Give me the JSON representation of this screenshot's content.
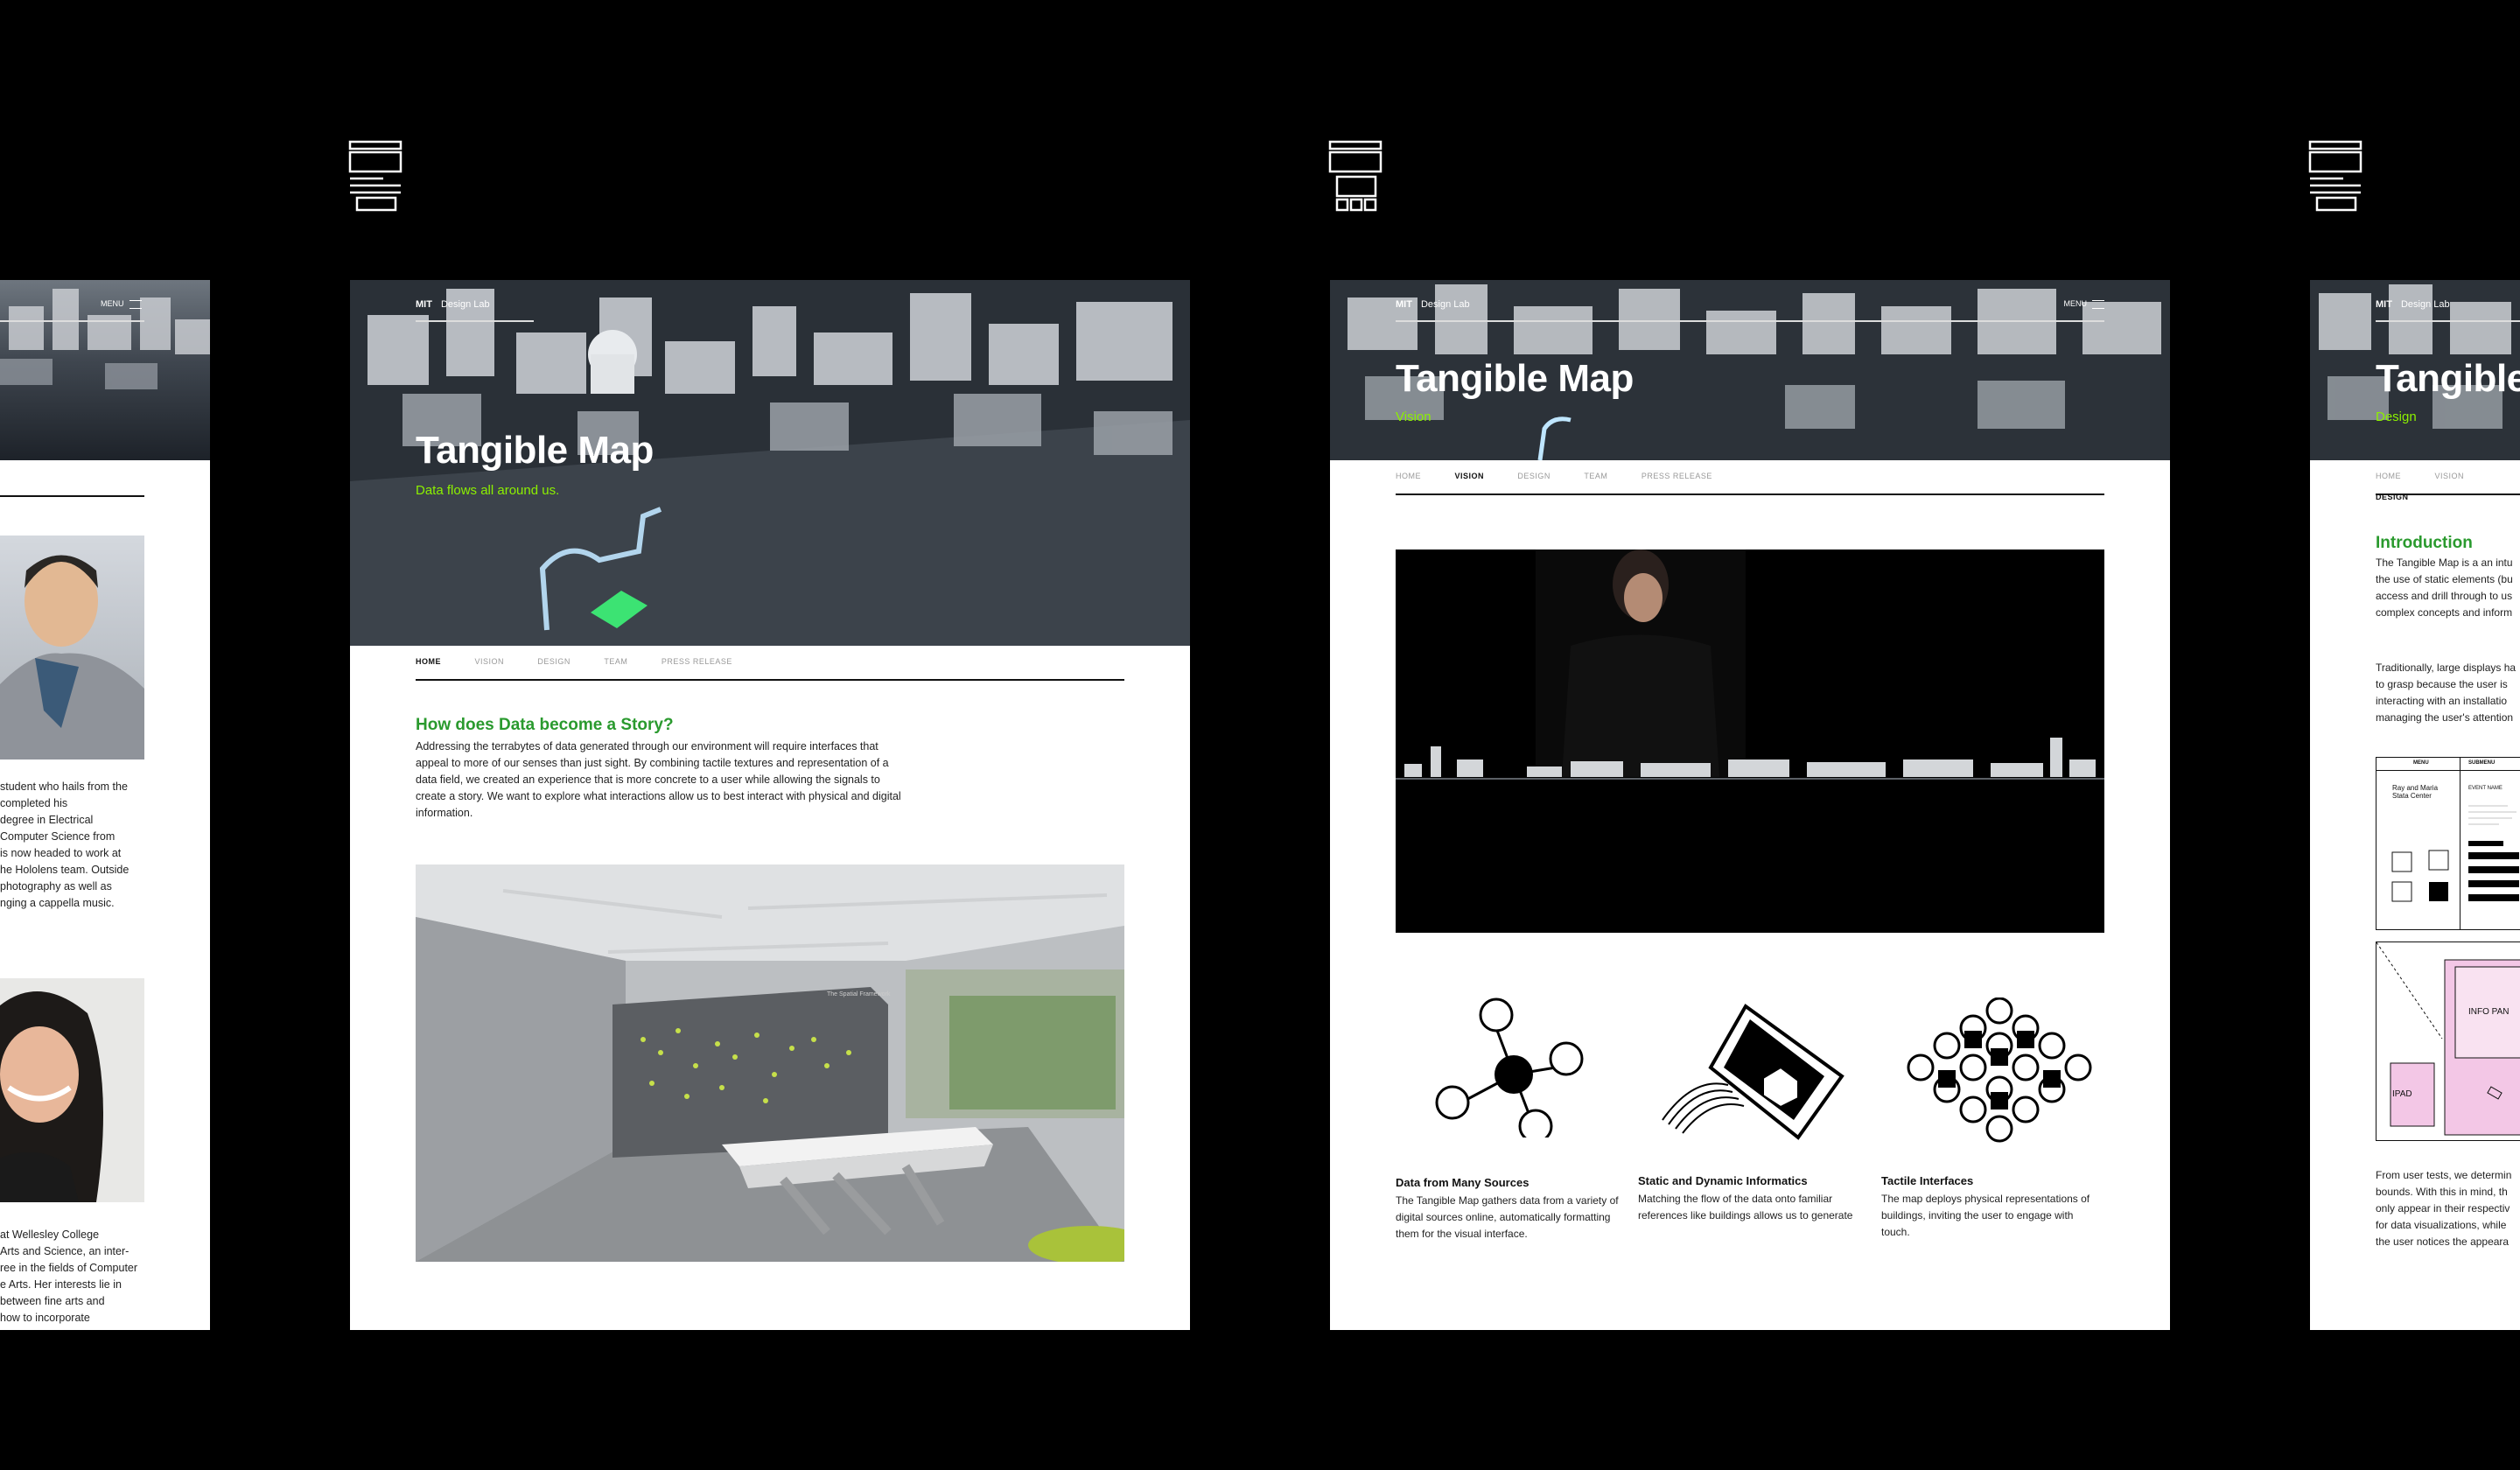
{
  "brand": {
    "mark": "MIT",
    "name": "Design Lab"
  },
  "menu_label": "MENU",
  "colors": {
    "accent_green": "#2a9a2e",
    "subtitle_green": "#8cf000",
    "background": "#000000",
    "pink": "#f3c7e6"
  },
  "team_panel": {
    "bio1": [
      "student who hails from the",
      "completed his",
      "degree in Electrical",
      "Computer Science from",
      "is now headed to work at",
      "he Hololens team. Outside",
      "photography as well as",
      "nging a cappella music."
    ],
    "bio2": [
      "at Wellesley College",
      "Arts and Science, an inter-",
      "ree in the fields of Computer",
      "e Arts. Her interests lie in",
      "between fine arts and",
      "how to incorporate"
    ]
  },
  "home_panel": {
    "title": "Tangible Map",
    "subtitle": "Data flows all around us.",
    "nav": [
      "HOME",
      "VISION",
      "DESIGN",
      "TEAM",
      "PRESS RELEASE"
    ],
    "active_tab": "HOME",
    "heading": "How does Data become a Story?",
    "paragraph": "Addressing the terrabytes of data generated through our environment will require interfaces that appeal to more of our senses than just sight. By combining tactile textures and representation of a data field, we created an experience that is more concrete to a user while allowing the signals to create a story. We want to explore what interactions allow us to best interact with physical and digital information.",
    "wall_text": "The Spatial Framework"
  },
  "vision_panel": {
    "title": "Tangible Map",
    "subtitle": "Vision",
    "nav": [
      "HOME",
      "VISION",
      "DESIGN",
      "TEAM",
      "PRESS RELEASE"
    ],
    "active_tab": "VISION",
    "features": [
      {
        "title": "Data from Many Sources",
        "text": "The Tangible Map gathers data from a variety of digital sources online, automatically formatting them for the visual interface.",
        "icon": "network-icon"
      },
      {
        "title": "Static and Dynamic Informatics",
        "text": "Matching the flow of the data onto familiar references like buildings allows us to generate",
        "icon": "building-flow-icon"
      },
      {
        "title": "Tactile Interfaces",
        "text": "The map deploys physical representations of buildings, inviting the user to engage with touch.",
        "icon": "pin-array-icon"
      }
    ]
  },
  "design_panel": {
    "title": "Tangible",
    "subtitle": "Design",
    "nav": [
      "HOME",
      "VISION",
      "DESIGN"
    ],
    "active_tab": "DESIGN",
    "heading": "Introduction",
    "para1": [
      "The Tangible Map is a an intu",
      "the use of static elements (bu",
      "access and drill through to us",
      "complex concepts and inform"
    ],
    "para2": [
      "Traditionally, large displays ha",
      "to grasp because the user is",
      "interacting with an installatio",
      "managing the user's attention"
    ],
    "para3": [
      "From user tests, we determin",
      "bounds. With this in mind, th",
      "only appear in their respectiv",
      "for data visualizations, while",
      "the user notices the appeara"
    ],
    "wire": {
      "menu": "MENU",
      "submenu": "SUBMENU",
      "building": "Ray and Maria Stata Center",
      "event": "EVENT NAME",
      "ipad": "IPAD",
      "info_panel": "INFO PAN"
    }
  }
}
